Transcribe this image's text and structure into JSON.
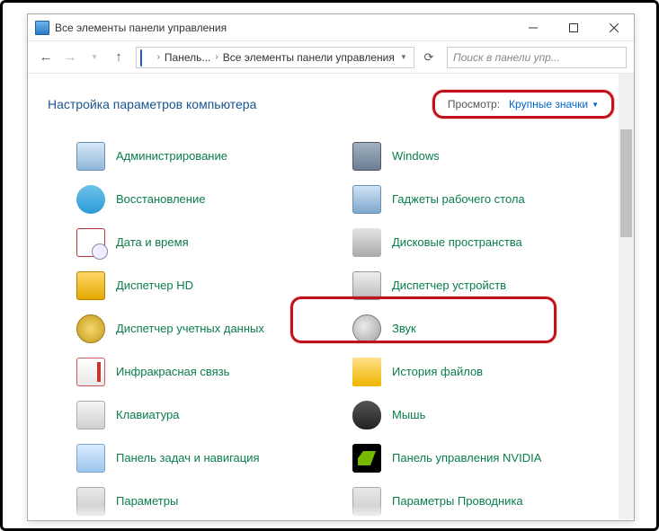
{
  "window": {
    "title": "Все элементы панели управления"
  },
  "nav": {
    "crumb1": "Панель...",
    "crumb2": "Все элементы панели управления",
    "search_placeholder": "Поиск в панели упр..."
  },
  "header": {
    "title": "Настройка параметров компьютера",
    "view_label": "Просмотр:",
    "view_value": "Крупные значки"
  },
  "items": [
    "Администрирование",
    "Windows",
    "Восстановление",
    "Гаджеты рабочего стола",
    "Дата и время",
    "Дисковые пространства",
    "Диспетчер HD",
    "Диспетчер устройств",
    "Диспетчер учетных данных",
    "Звук",
    "Инфракрасная связь",
    "История файлов",
    "Клавиатура",
    "Мышь",
    "Панель задач и навигация",
    "Панель управления NVIDIA",
    "Параметры",
    "Параметры Проводника"
  ],
  "colors": {
    "link": "#0a7d4a",
    "heading": "#1a5490",
    "annotation": "#c2111a",
    "hyperlink": "#0066cc"
  }
}
